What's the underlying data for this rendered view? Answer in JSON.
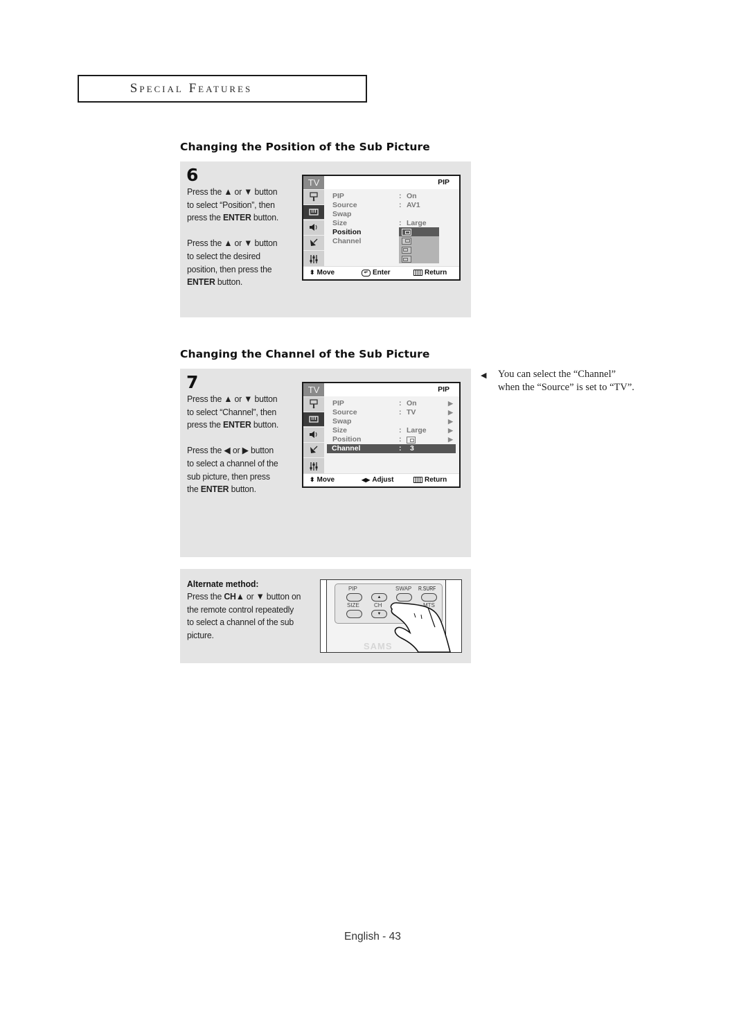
{
  "header": {
    "section_label": "Special Features"
  },
  "section_position": {
    "title": "Changing the Position of the Sub Picture",
    "step_number": "6",
    "instructions": [
      {
        "parts": [
          {
            "t": "Press the ▲ or ▼ button"
          },
          {
            "br": true
          },
          {
            "t": "to select “Position”, then"
          },
          {
            "br": true
          },
          {
            "t": "press the "
          },
          {
            "b": "ENTER"
          },
          {
            "t": " button."
          }
        ]
      },
      {
        "parts": [
          {
            "t": "Press the ▲ or ▼ button"
          },
          {
            "br": true
          },
          {
            "t": "to select the desired"
          },
          {
            "br": true
          },
          {
            "t": "position, then press the"
          },
          {
            "br": true
          },
          {
            "b": "ENTER"
          },
          {
            "t": " button."
          }
        ]
      }
    ],
    "osd": {
      "tab_label": "TV",
      "menu_title": "PIP",
      "sidebar_icons": [
        "input-icon",
        "picture-icon",
        "sound-icon",
        "channel-icon",
        "setup-icon"
      ],
      "active_sidebar_index": 1,
      "rows": [
        {
          "label": "PIP",
          "colon": ":",
          "value": "On"
        },
        {
          "label": "Source",
          "colon": ":",
          "value": "AV1"
        },
        {
          "label": "Swap",
          "colon": "",
          "value": ""
        },
        {
          "label": "Size",
          "colon": ":",
          "value": "Large"
        },
        {
          "label": "Position",
          "colon": ":",
          "value": ""
        },
        {
          "label": "Channel",
          "colon": ":",
          "value": ""
        }
      ],
      "selected_row": "Position",
      "position_options": [
        "bottom-right",
        "top-right",
        "top-left",
        "bottom-left"
      ],
      "selected_position_option": 0,
      "footer": {
        "move": "Move",
        "enter": "Enter",
        "return": "Return"
      }
    }
  },
  "section_channel": {
    "title": "Changing the Channel of the Sub Picture",
    "step_number": "7",
    "instructions": [
      {
        "parts": [
          {
            "t": "Press the ▲ or ▼ button"
          },
          {
            "br": true
          },
          {
            "t": "to select “Channel”, then"
          },
          {
            "br": true
          },
          {
            "t": "press the "
          },
          {
            "b": "ENTER"
          },
          {
            "t": " button."
          }
        ]
      },
      {
        "parts": [
          {
            "t": "Press the ◀ or ▶ button"
          },
          {
            "br": true
          },
          {
            "t": "to select a channel of the"
          },
          {
            "br": true
          },
          {
            "t": "sub picture, then press"
          },
          {
            "br": true
          },
          {
            "t": "the "
          },
          {
            "b": "ENTER"
          },
          {
            "t": " button."
          }
        ]
      }
    ],
    "osd": {
      "tab_label": "TV",
      "menu_title": "PIP",
      "rows": [
        {
          "label": "PIP",
          "colon": ":",
          "value": "On",
          "arrow": "▶"
        },
        {
          "label": "Source",
          "colon": ":",
          "value": "TV",
          "arrow": "▶"
        },
        {
          "label": "Swap",
          "colon": "",
          "value": "",
          "arrow": "▶"
        },
        {
          "label": "Size",
          "colon": ":",
          "value": "Large",
          "arrow": "▶"
        },
        {
          "label": "Position",
          "colon": ":",
          "value": "",
          "arrow": "▶"
        },
        {
          "label": "Channel",
          "colon": ":",
          "value": "3",
          "arrow": ""
        }
      ],
      "selected_row": "Channel",
      "footer": {
        "move": "Move",
        "adjust": "Adjust",
        "return": "Return"
      }
    },
    "note": {
      "arrow": "◀",
      "lines": [
        "You can select the “Channel”",
        "when the “Source” is set to “TV”."
      ]
    }
  },
  "alternate": {
    "title": "Alternate method:",
    "parts": [
      {
        "t": "Press the "
      },
      {
        "b": "CH▲"
      },
      {
        "t": " or ▼ button on"
      },
      {
        "br": true
      },
      {
        "t": "the remote control repeatedly"
      },
      {
        "br": true
      },
      {
        "t": "to select a channel of the sub"
      },
      {
        "br": true
      },
      {
        "t": "picture."
      }
    ],
    "remote": {
      "labels": {
        "pip": "PIP",
        "swap": "SWAP",
        "rsurf": "R.SURF",
        "size": "SIZE",
        "ch": "CH",
        "mts": "MTS",
        "brand": "SAMS"
      }
    }
  },
  "footer": {
    "page_label": "English - 43"
  }
}
